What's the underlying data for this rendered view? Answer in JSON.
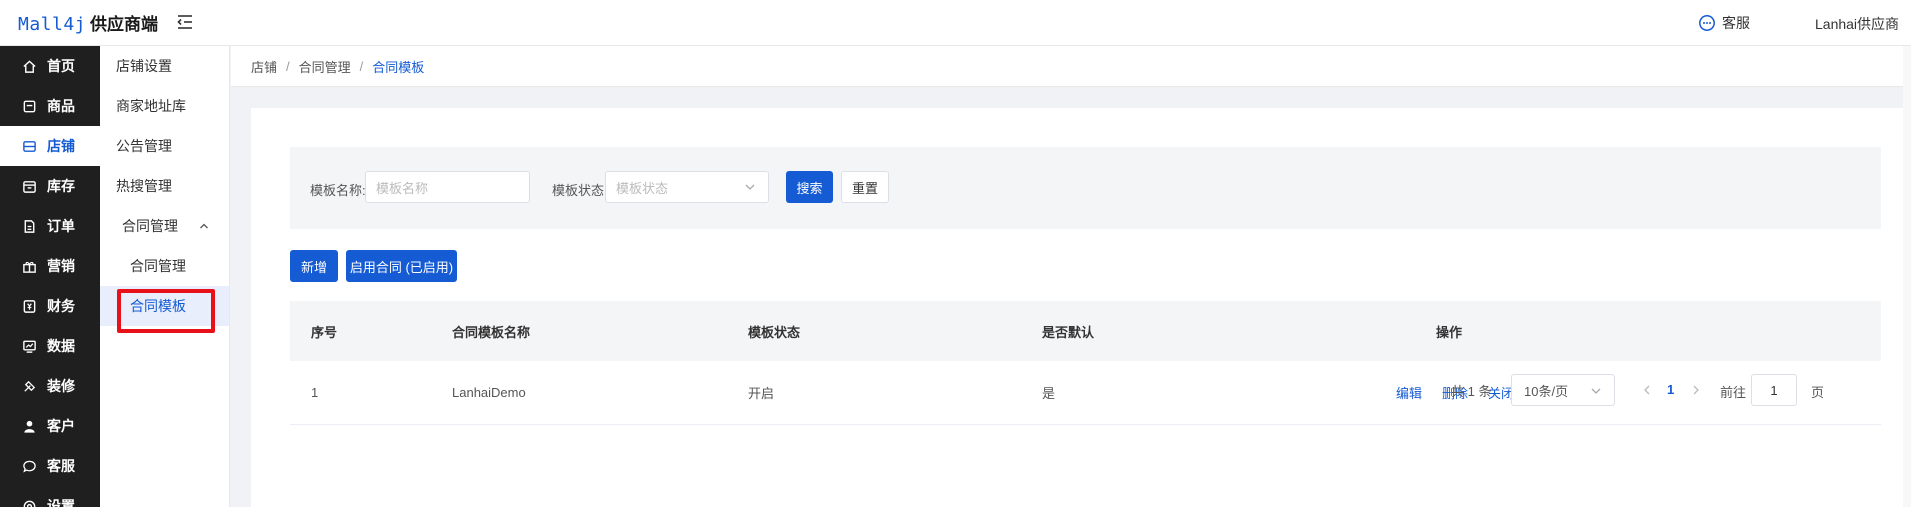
{
  "app": {
    "logo_brand": "Mall4j",
    "logo_sub": "供应商端",
    "service_label": "客服",
    "username": "Lanhai供应商"
  },
  "main_nav": [
    {
      "label": "首页",
      "icon": "home-icon"
    },
    {
      "label": "商品",
      "icon": "goods-icon"
    },
    {
      "label": "店铺",
      "icon": "shop-icon",
      "active": true
    },
    {
      "label": "库存",
      "icon": "stock-icon"
    },
    {
      "label": "订单",
      "icon": "order-icon"
    },
    {
      "label": "营销",
      "icon": "gift-icon"
    },
    {
      "label": "财务",
      "icon": "finance-icon"
    },
    {
      "label": "数据",
      "icon": "data-icon"
    },
    {
      "label": "装修",
      "icon": "decorate-icon"
    },
    {
      "label": "客户",
      "icon": "user-icon"
    },
    {
      "label": "客服",
      "icon": "chat-icon"
    },
    {
      "label": "设置",
      "icon": "gear-icon"
    }
  ],
  "sub_nav": {
    "items": [
      "店铺设置",
      "商家地址库",
      "公告管理",
      "热搜管理"
    ],
    "group_label": "合同管理",
    "children": [
      "合同管理",
      "合同模板"
    ]
  },
  "breadcrumb": [
    "店铺",
    "合同管理",
    "合同模板"
  ],
  "search": {
    "name_label": "模板名称:",
    "name_placeholder": "模板名称",
    "status_label": "模板状态:",
    "status_placeholder": "模板状态",
    "search_button": "搜索",
    "reset_button": "重置"
  },
  "actions": {
    "add_button": "新增",
    "enable_button": "启用合同 (已启用)"
  },
  "table": {
    "headers": [
      "序号",
      "合同模板名称",
      "模板状态",
      "是否默认",
      "操作"
    ],
    "rows": [
      {
        "index": "1",
        "name": "LanhaiDemo",
        "status": "开启",
        "default": "是"
      }
    ],
    "row_actions": [
      "编辑",
      "删除",
      "关闭"
    ]
  },
  "pagination": {
    "total": "共 1 条",
    "page_size": "10条/页",
    "current_page": "1",
    "goto_label": "前往",
    "goto_value": "1",
    "page_suffix": "页"
  },
  "colors": {
    "accent": "#155bd4",
    "sidebar_bg": "#1f1f1f",
    "highlight_box": "#e8111a"
  }
}
